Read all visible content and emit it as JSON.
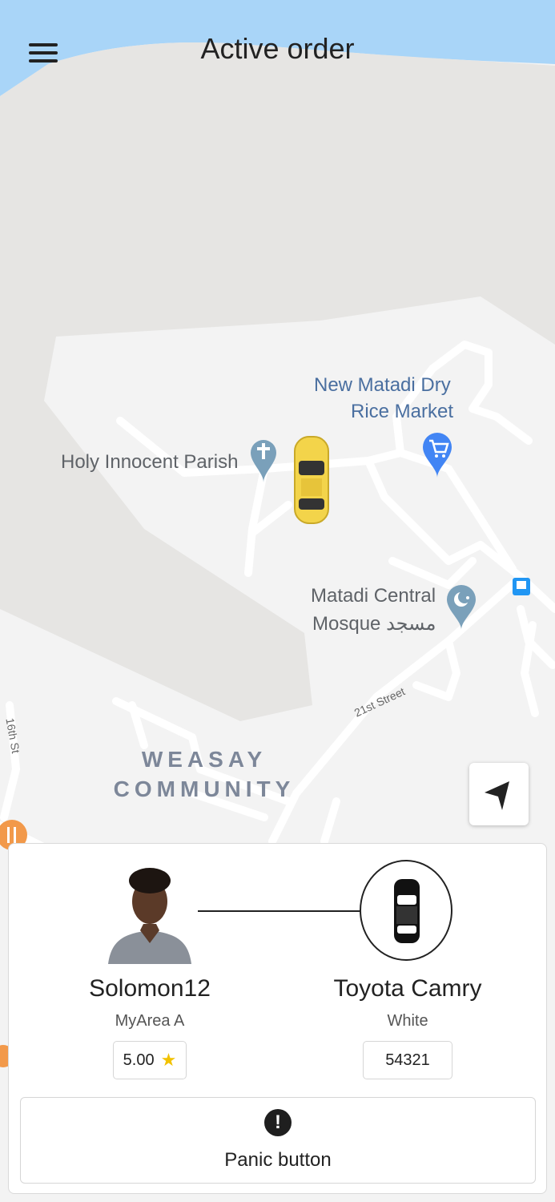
{
  "header": {
    "title": "Active order"
  },
  "map": {
    "labels": {
      "market_line1": "New Matadi Dry",
      "market_line2": "Rice Market",
      "parish": "Holy Innocent Parish",
      "mosque_line1": "Matadi Central",
      "mosque_line2": "Mosque مسجد",
      "community_line1": "WEASAY",
      "community_line2": "COMMUNITY",
      "street_21st": "21st Street",
      "street_16th": "16th St"
    },
    "colors": {
      "water": "#a9d5f8",
      "land": "#f1f1f1",
      "land_dark": "#e6e5e3",
      "road": "#ffffff",
      "car": "#f3d44a",
      "poi_blue": "#4285f4",
      "poi_gray": "#7aa0ba"
    }
  },
  "driver": {
    "name": "Solomon12",
    "area": "MyArea A",
    "rating": "5.00",
    "rating_icon": "star-icon"
  },
  "vehicle": {
    "model": "Toyota Camry",
    "color": "White",
    "plate": "54321"
  },
  "panic": {
    "label": "Panic button",
    "icon": "exclamation-icon"
  }
}
